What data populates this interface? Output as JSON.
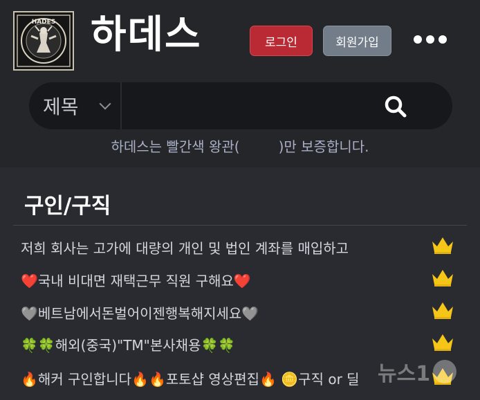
{
  "header": {
    "site_title": "하데스",
    "logo_text": "HADES",
    "login_label": "로그인",
    "join_label": "회원가입",
    "more_icon": "more-dots-icon"
  },
  "search": {
    "category": "제목",
    "query": "",
    "icon": "search-icon"
  },
  "notice": {
    "before": "하데스는 빨간색 왕관(",
    "after": ")만 보증합니다."
  },
  "section": {
    "title": "구인/구직"
  },
  "posts": [
    {
      "title": "저희 회사는 고가에 대량의 개인 및 법인 계좌를 매입하고",
      "badge": "crown-icon"
    },
    {
      "title": "❤️국내 비대면 재택근무 직원 구해요❤️",
      "badge": "crown-icon"
    },
    {
      "title": "🩶베트남에서돈벌어이젠행복해지세요🩶",
      "badge": "crown-icon"
    },
    {
      "title": "🍀🍀해외(중국)\"TM\"본사채용🍀🍀",
      "badge": "crown-icon"
    },
    {
      "title": "🔥해커 구인합니다🔥🔥포토샵 영상편집🔥 🪙구직 or 딜",
      "badge": "crown-icon"
    }
  ],
  "watermark": {
    "text": "뉴스1"
  },
  "colors": {
    "crown": "#f5c518",
    "login": "#b92a34",
    "join": "#727d89",
    "background": "#2a2b30"
  }
}
